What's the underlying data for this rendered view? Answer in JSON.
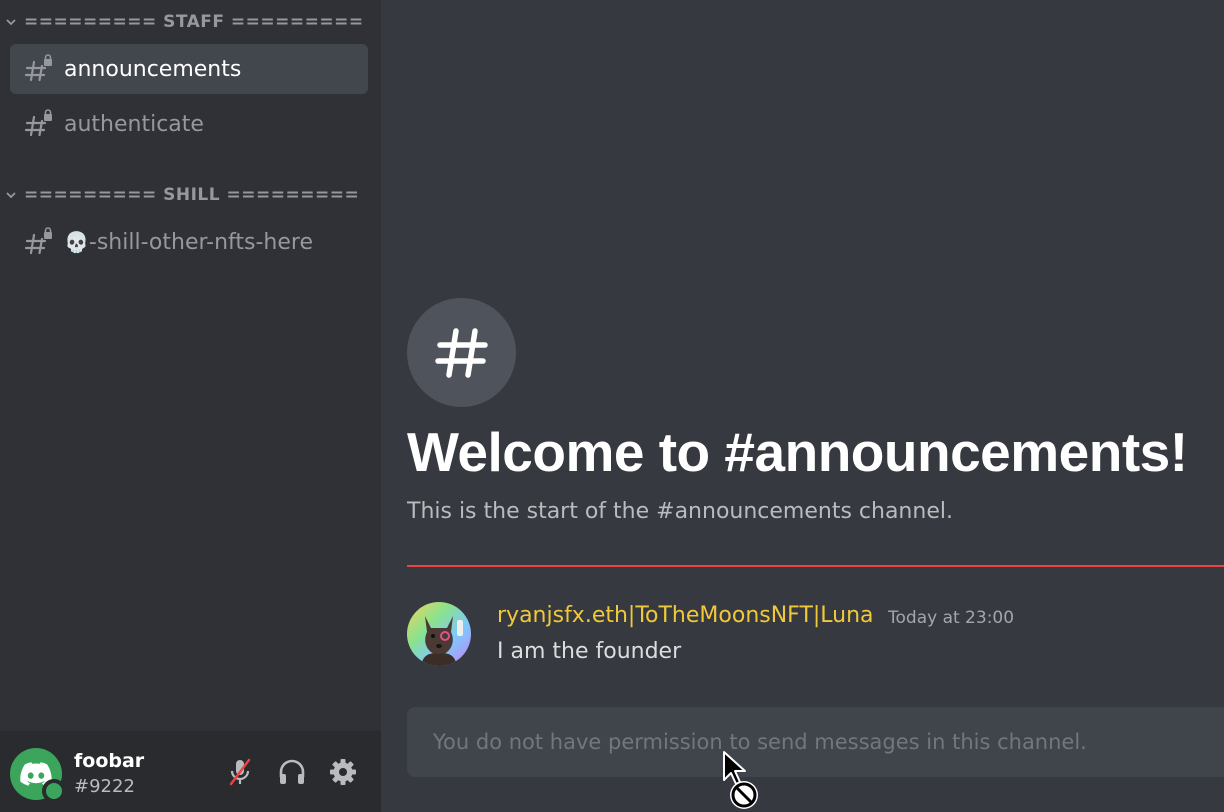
{
  "sidebar": {
    "categories": [
      {
        "label": "========= STAFF ========="
      },
      {
        "label": "========= SHILL ========="
      }
    ],
    "channels": [
      {
        "label": "announcements",
        "active": true
      },
      {
        "label": "authenticate"
      },
      {
        "emoji": "💀",
        "label": "-shill-other-nfts-here"
      }
    ]
  },
  "user": {
    "name": "foobar",
    "tag": "#9222",
    "status": "online"
  },
  "main": {
    "welcome_title": "Welcome to #announcements!",
    "welcome_subtitle": "This is the start of the #announcements channel.",
    "message": {
      "author": "ryanjsfx.eth|ToTheMoonsNFT|Luna",
      "timestamp": "Today at 23:00",
      "text": "I am the founder"
    },
    "composer_placeholder": "You do not have permission to send messages in this channel."
  },
  "colors": {
    "accent_green": "#3ba55c",
    "divider_red": "#ed4245",
    "author_gold": "#f0c93a"
  },
  "icons": [
    "chevron-down-icon",
    "locked-channel-hash-icon",
    "hash-icon",
    "muted-microphone-icon",
    "headphones-icon",
    "gear-icon",
    "discord-logo-icon",
    "not-allowed-cursor-icon"
  ]
}
